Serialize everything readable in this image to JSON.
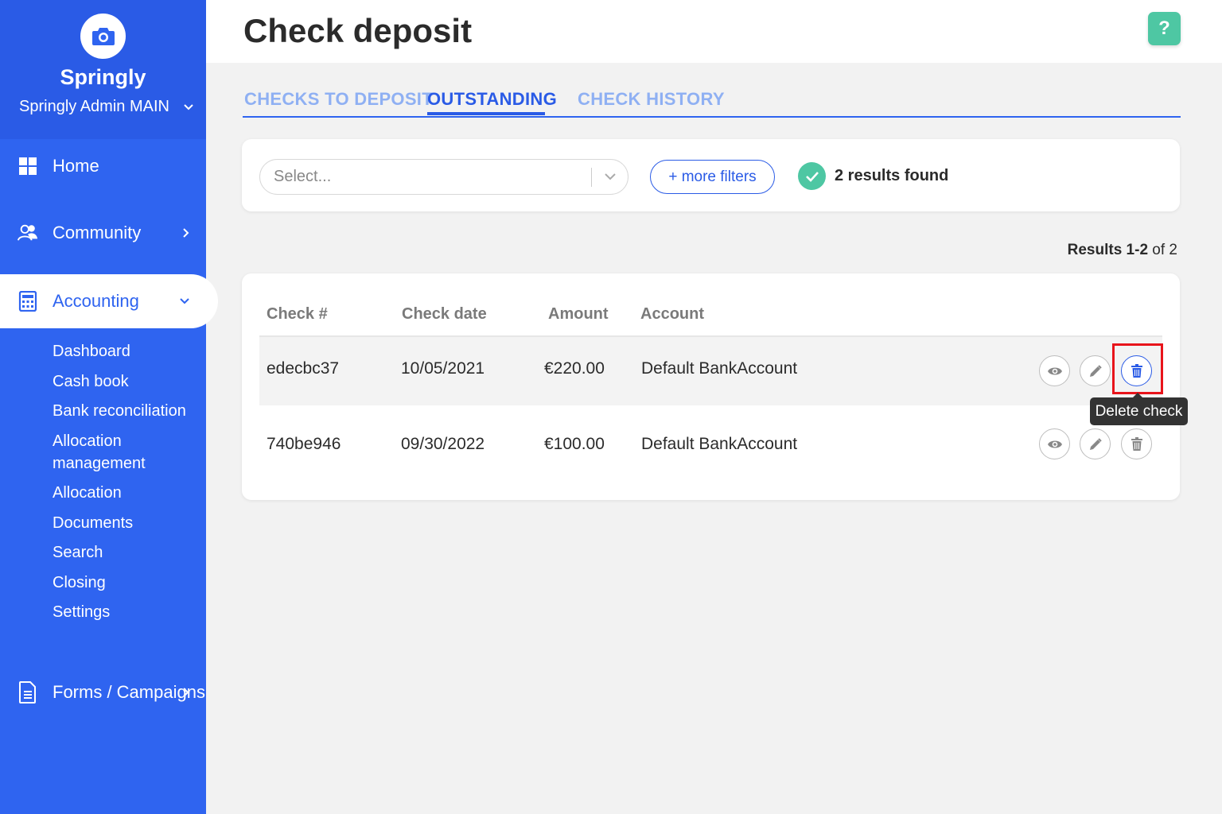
{
  "app": {
    "brand_name": "Springly",
    "org_name": "Springly Admin MAIN"
  },
  "sidebar": {
    "items": [
      {
        "label": "Home",
        "icon": "grid-icon"
      },
      {
        "label": "Community",
        "icon": "users-icon"
      },
      {
        "label": "Accounting",
        "icon": "calculator-icon"
      },
      {
        "label": "Forms / Campaigns",
        "icon": "document-icon"
      }
    ],
    "accounting_sub": [
      "Dashboard",
      "Cash book",
      "Bank reconciliation",
      "Allocation management",
      "Allocation",
      "Documents",
      "Search",
      "Closing",
      "Settings"
    ]
  },
  "header": {
    "title": "Check deposit",
    "help_label": "?"
  },
  "tabs": [
    {
      "label": "CHECKS TO DEPOSIT",
      "active": false
    },
    {
      "label": "OUTSTANDING",
      "active": true
    },
    {
      "label": "CHECK HISTORY",
      "active": false
    }
  ],
  "filters": {
    "select_placeholder": "Select...",
    "more_filters_label": "+ more filters",
    "results_found": "2 results found"
  },
  "pagination": {
    "prefix": "Results",
    "range": "1-2",
    "of": "of 2"
  },
  "table": {
    "columns": [
      "Check #",
      "Check date",
      "Amount",
      "Account"
    ],
    "rows": [
      {
        "check": "edecbc37",
        "date": "10/05/2021",
        "amount": "€220.00",
        "account": "Default BankAccount"
      },
      {
        "check": "740be946",
        "date": "09/30/2022",
        "amount": "€100.00",
        "account": "Default BankAccount"
      }
    ]
  },
  "tooltip": {
    "label": "Delete check"
  },
  "colors": {
    "sidebar": "#2f64f0",
    "accent": "#2a5be6",
    "success": "#4ec7a3",
    "highlight": "#e8141b"
  }
}
